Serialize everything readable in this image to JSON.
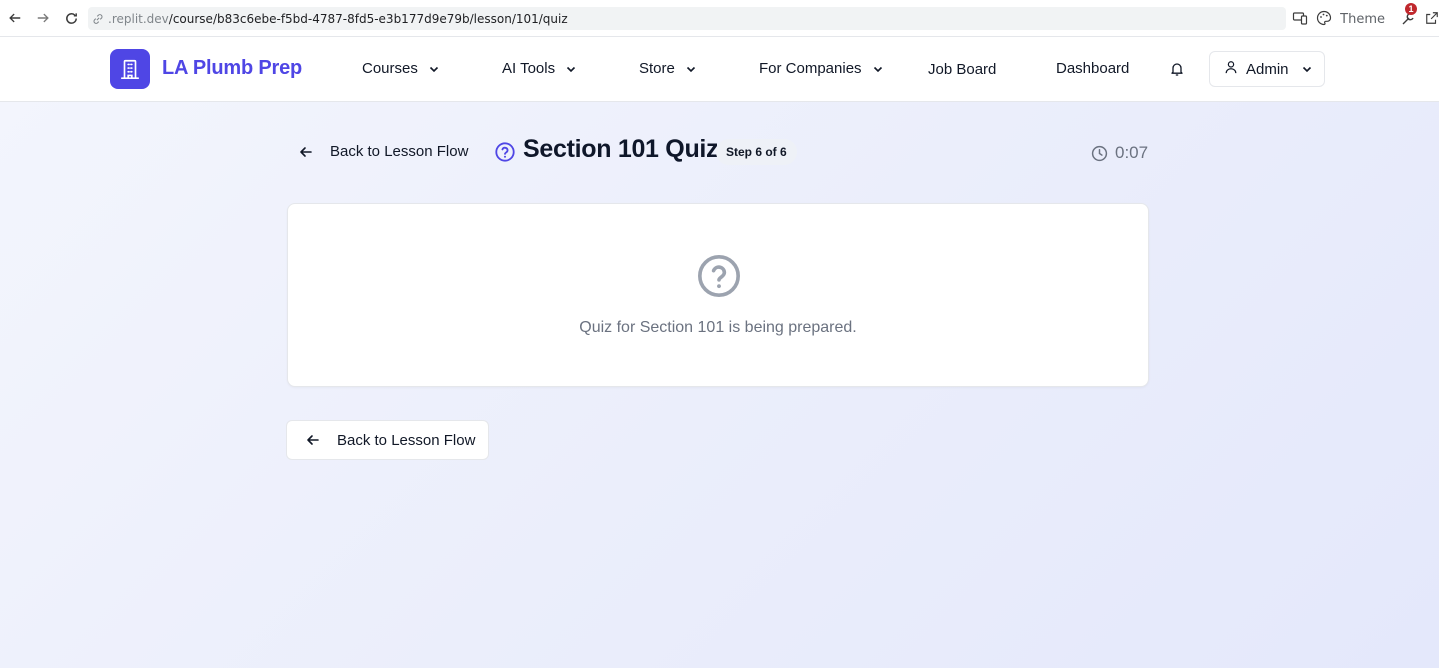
{
  "browser": {
    "url_domain": ".replit.dev",
    "url_path": "/course/b83c6ebe-f5bd-4787-8fd5-e3b177d9e79b/lesson/101/quiz",
    "theme_label": "Theme",
    "extension_badge": "1"
  },
  "header": {
    "brand": "LA Plumb Prep",
    "nav": [
      {
        "label": "Courses",
        "has_dropdown": true
      },
      {
        "label": "AI Tools",
        "has_dropdown": true
      },
      {
        "label": "Store",
        "has_dropdown": true
      },
      {
        "label": "For Companies",
        "has_dropdown": true
      },
      {
        "label": "Job Board",
        "has_dropdown": false
      },
      {
        "label": "Dashboard",
        "has_dropdown": false
      }
    ],
    "user_label": "Admin"
  },
  "page": {
    "back_label": "Back to Lesson Flow",
    "title": "Section 101 Quiz",
    "step_badge": "Step 6 of 6",
    "timer": "0:07",
    "placeholder_message": "Quiz for Section 101 is being prepared.",
    "back_bottom_label": "Back to Lesson Flow"
  },
  "colors": {
    "brand": "#4f46e5",
    "background": "#eef0fb",
    "muted_text": "#6b7280"
  }
}
